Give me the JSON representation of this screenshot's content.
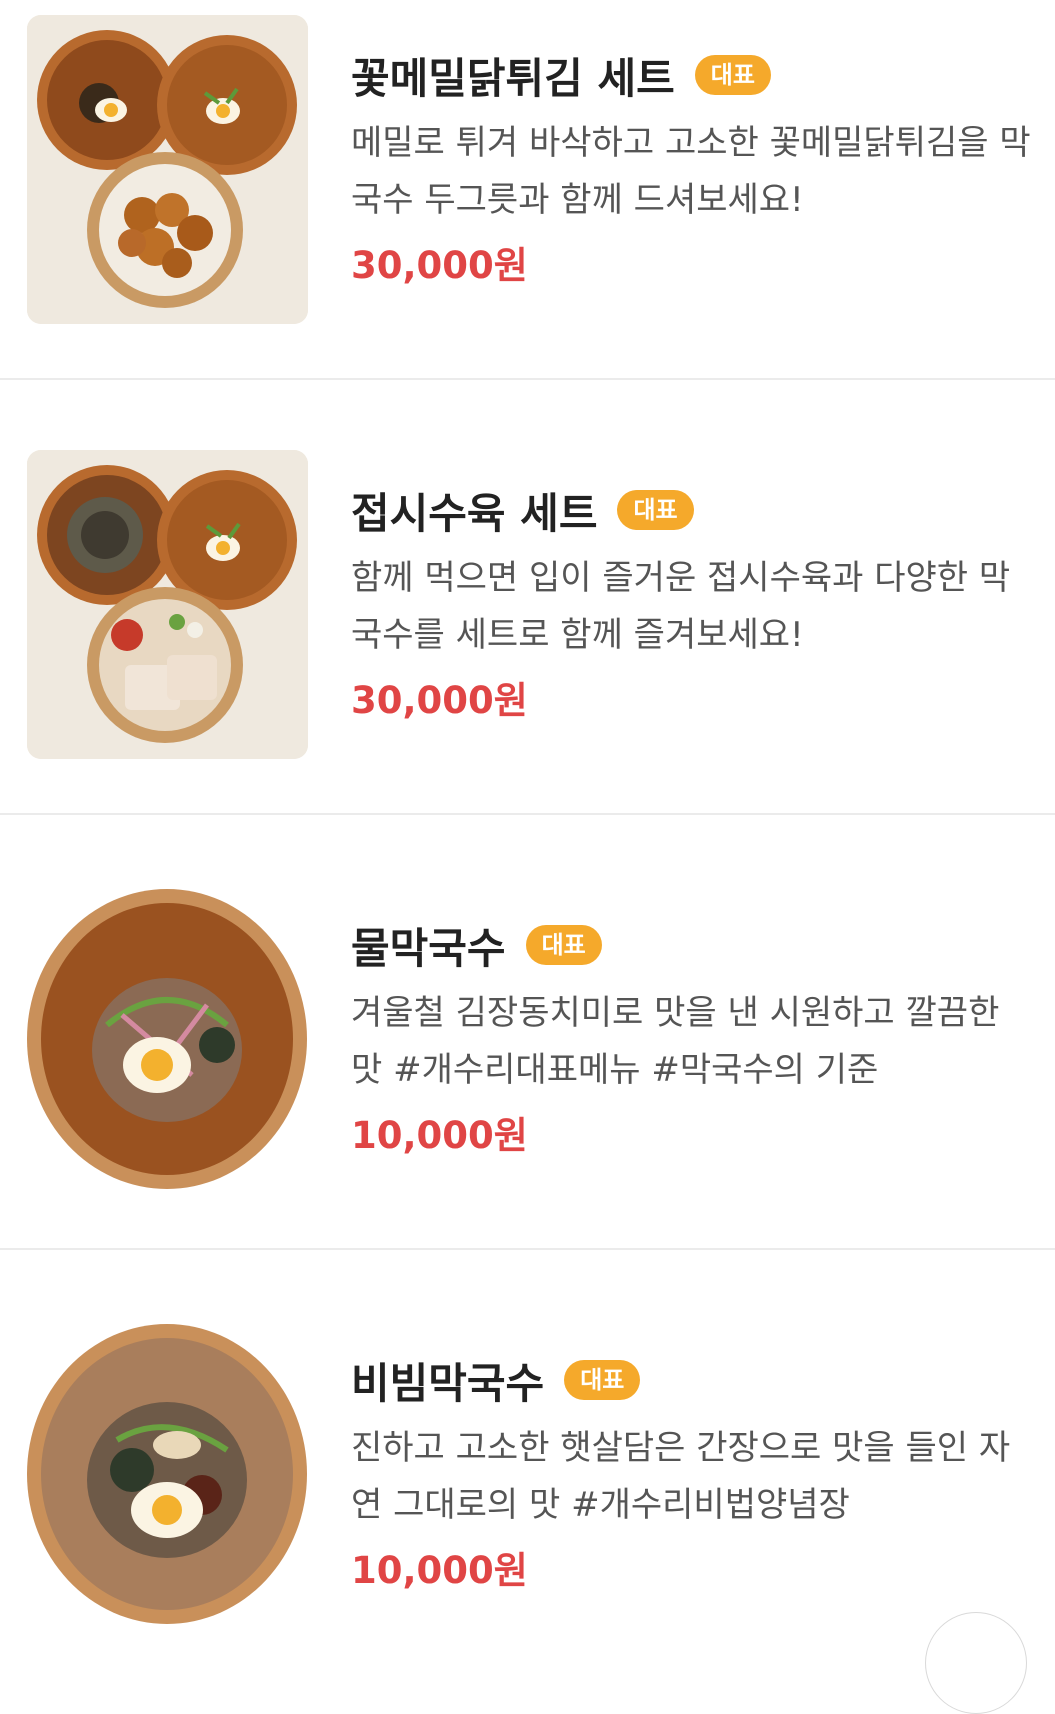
{
  "menu": {
    "items": [
      {
        "name": "꽃메밀닭튀김 세트",
        "badge": "대표",
        "description": "메밀로 튀겨 바삭하고 고소한 꽃메밀닭튀김을 막국수 두그릇과 함께 드셔보세요!",
        "price": "30,000원"
      },
      {
        "name": "접시수육 세트",
        "badge": "대표",
        "description": "함께 먹으면 입이 즐거운 접시수육과 다양한 막국수를 세트로 함께 즐겨보세요!",
        "price": "30,000원"
      },
      {
        "name": "물막국수",
        "badge": "대표",
        "description": "겨울철 김장동치미로 맛을 낸 시원하고 깔끔한 맛 #개수리대표메뉴 #막국수의 기준",
        "price": "10,000원"
      },
      {
        "name": "비빔막국수",
        "badge": "대표",
        "description": "진하고 고소한 햇살담은 간장으로 맛을 들인 자연 그대로의 맛 #개수리비법양념장",
        "price": "10,000원"
      }
    ]
  },
  "colors": {
    "badge": "#f5a92b",
    "price": "#e04545",
    "title": "#222222",
    "description": "#555555"
  }
}
